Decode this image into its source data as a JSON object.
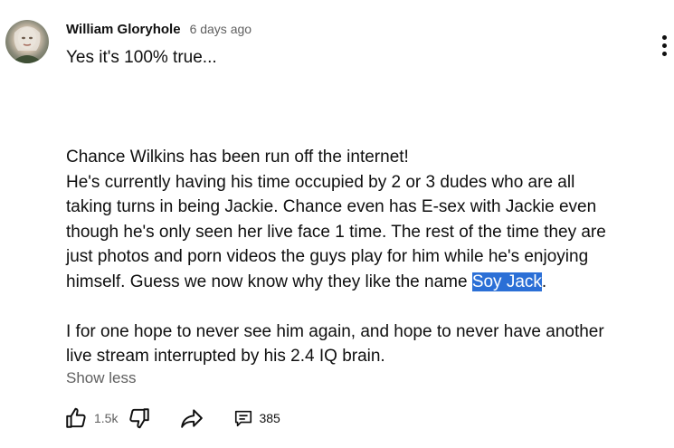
{
  "comment": {
    "author": "William Gloryhole",
    "timestamp": "6 days ago",
    "first_line": "Yes it's 100% true...",
    "paragraph1_lines": [
      "Chance Wilkins has been run off the internet!",
      "He's currently  having his time occupied by 2 or 3 dudes who are all",
      "taking turns in being Jackie. Chance even has E-sex with Jackie even",
      "though he's only seen her live face 1 time. The rest of the time they are",
      "just photos and porn videos the guys play for him while he's enjoying"
    ],
    "last_line_before": "himself. Guess we now know why they like the name ",
    "last_line_selected": "Soy Jack",
    "last_line_after": ".",
    "paragraph2_lines": [
      "I for one hope to never see him again, and hope to never have another",
      "live stream interrupted by his 2.4 IQ brain."
    ],
    "show_less_label": "Show less"
  },
  "actions": {
    "like_count": "1.5k",
    "reply_count": "385"
  },
  "icons": {
    "menu": "more-vertical-icon",
    "like": "thumbs-up-icon",
    "dislike": "thumbs-down-icon",
    "share": "share-icon",
    "replies": "comment-icon"
  },
  "colors": {
    "selection": "#2b6fd6",
    "secondary_text": "#606060"
  }
}
